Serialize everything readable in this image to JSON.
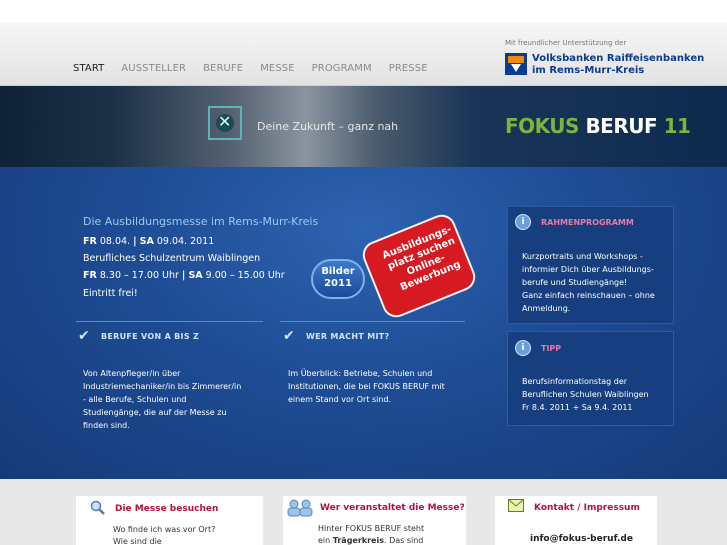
{
  "nav": {
    "items": [
      "START",
      "AUSSTELLER",
      "BERUFE",
      "MESSE",
      "PROGRAMM",
      "PRESSE"
    ]
  },
  "sponsor": {
    "note": "Mit freundlicher Unterstützung der",
    "name_line1": "Volksbanken Raiffeisenbanken",
    "name_line2": "im Rems-Murr-Kreis"
  },
  "banner": {
    "tagline": "Deine Zukunft – ganz nah",
    "logo_fokus": "FOKUS",
    "logo_beruf": "BERUF",
    "logo_num": "11"
  },
  "event": {
    "title": "Die Ausbildungsmesse im Rems-Murr-Kreis",
    "dates_fr": "FR",
    "dates_fr_val": "08.04.",
    "dates_sep": "|",
    "dates_sa": "SA",
    "dates_sa_val": "09.04. 2011",
    "venue": "Berufliches Schulzentrum Waiblingen",
    "times_fr": "FR",
    "times_fr_val": "8.30 – 17.00 Uhr",
    "times_sep": "|",
    "times_sa": "SA",
    "times_sa_val": "9.00 – 15.00 Uhr",
    "entry": "Eintritt frei!"
  },
  "badges": {
    "bilder_line1": "Bilder",
    "bilder_line2": "2011",
    "red_line1": "Ausbildungs-",
    "red_line2": "platz suchen",
    "red_line3": "Online-",
    "red_line4": "Bewerbung"
  },
  "sections": {
    "berufe": {
      "head": "BERUFE VON A BIS Z",
      "text": [
        "Von Altenpfleger/in über",
        "Industriemechaniker/in bis Zimmerer/in",
        "- alle Berufe, Schulen und",
        "Studiengänge, die auf der Messe zu",
        "finden sind."
      ]
    },
    "wer": {
      "head": "WER MACHT MIT?",
      "text": [
        "Im Überblick: Betriebe, Schulen und",
        "Institutionen, die bei FOKUS BERUF mit",
        "einem Stand vor Ort sind."
      ]
    }
  },
  "sidebar": {
    "rahmen": {
      "head": "RAHMENPROGRAMM",
      "text": [
        "Kurzportraits und Workshops -",
        "informier Dich über Ausbildungs-",
        "berufe und Studiengänge!",
        "Ganz einfach reinschauen – ohne",
        "Anmeldung."
      ]
    },
    "tipp": {
      "head": "TIPP",
      "text": [
        "Berufsinformationstag der",
        "Beruflichen Schulen Waiblingen",
        "Fr  8.4. 2011  + Sa  9.4. 2011"
      ]
    }
  },
  "footer": {
    "messe": {
      "head": "Die Messe besuchen",
      "text": [
        "Wo finde ich was vor Ort?",
        "Wie sind die"
      ]
    },
    "veranstalter": {
      "head": "Wer veranstaltet die Messe?",
      "text1": "Hinter FOKUS BERUF steht",
      "text2_pre": "ein ",
      "text2_bold": "Trägerkreis",
      "text2_post": ". Das sind"
    },
    "kontakt": {
      "head": "Kontakt / Impressum",
      "email": "info@fokus-beruf.de"
    }
  }
}
